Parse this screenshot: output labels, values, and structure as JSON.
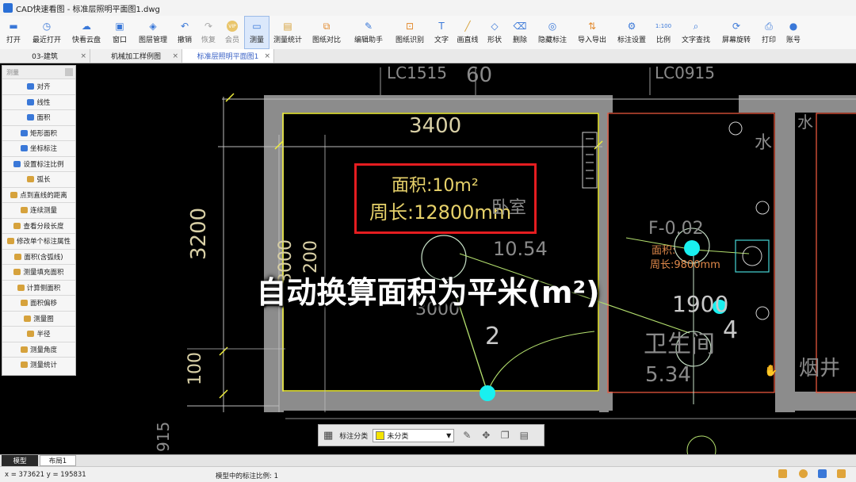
{
  "window": {
    "title": "CAD快速看图 - 标准层照明平面图1.dwg"
  },
  "ribbon": {
    "tools": [
      {
        "label": "打开",
        "icon": "folder-icon"
      },
      {
        "label": "最近打开",
        "icon": "clock-icon"
      },
      {
        "label": "快看云盘",
        "icon": "cloud-icon"
      },
      {
        "label": "窗口",
        "icon": "window-icon"
      },
      {
        "label": "图层管理",
        "icon": "layers-icon"
      },
      {
        "label": "撤销",
        "icon": "undo-icon"
      },
      {
        "label": "恢复",
        "icon": "redo-icon"
      },
      {
        "label": "会员",
        "icon": "vip-icon"
      },
      {
        "label": "测量",
        "icon": "measure-icon"
      },
      {
        "label": "测量统计",
        "icon": "measure-stats-icon"
      },
      {
        "label": "图纸对比",
        "icon": "compare-icon"
      },
      {
        "label": "编辑助手",
        "icon": "edit-helper-icon"
      },
      {
        "label": "图纸识别",
        "icon": "recognize-icon"
      },
      {
        "label": "文字",
        "icon": "text-icon"
      },
      {
        "label": "画直线",
        "icon": "line-icon"
      },
      {
        "label": "形状",
        "icon": "shape-icon"
      },
      {
        "label": "删除",
        "icon": "eraser-icon"
      },
      {
        "label": "隐藏标注",
        "icon": "hide-icon"
      },
      {
        "label": "导入导出",
        "icon": "import-export-icon"
      },
      {
        "label": "标注设置",
        "icon": "settings-icon"
      },
      {
        "label": "比例",
        "icon": "scale-icon"
      },
      {
        "label": "文字查找",
        "icon": "search-icon"
      },
      {
        "label": "屏幕旋转",
        "icon": "rotate-icon"
      },
      {
        "label": "打印",
        "icon": "print-icon"
      },
      {
        "label": "账号",
        "icon": "user-icon"
      }
    ],
    "scale_icon_text": "1:100",
    "vip_icon_text": "VIP"
  },
  "tabs": [
    {
      "label": "03-建筑"
    },
    {
      "label": "机械加工样例图"
    },
    {
      "label": "标准层照明平面图1"
    }
  ],
  "measure_panel": {
    "header": "测量",
    "items": [
      "对齐",
      "线性",
      "面积",
      "矩形面积",
      "坐标标注",
      "设置标注比例",
      "弧长",
      "点到直线的距离",
      "连续测量",
      "查看分段长度",
      "修改单个标注属性",
      "面积(含弧线)",
      "测量填充面积",
      "计算侧面积",
      "面积偏移",
      "测量图",
      "半径",
      "测量角度",
      "测量统计"
    ]
  },
  "drawing": {
    "dim_top": "3400",
    "dim_left": "3200",
    "dim_left2": "3000",
    "dim_left3": "200",
    "dim_left4": "100",
    "dim_bottom_left": "915",
    "top_label_1": "LC1515",
    "top_label_2": "60",
    "top_label_3": "LC0915",
    "measure_area": "面积:10m²",
    "measure_perimeter": "周长:12800mm",
    "room_label": "卧室",
    "room_area": "10.54",
    "mid_dim": "3000",
    "wire_num": "2",
    "right_label": "F-0.02",
    "right_area_small": "面积:",
    "right_perim_small": "周长:9800mm",
    "dim_1900": "1900",
    "num_4": "4",
    "bath_label": "卫生间",
    "bath_area": "5.34",
    "water_label": "水",
    "flue_label": "烟井",
    "top_right_char": "水"
  },
  "overlay_caption": "自动换算面积为平米(m²)",
  "floatbar": {
    "label": "标注分类",
    "selected": "未分类",
    "swatch_color": "#f4e300"
  },
  "bottom_tabs": [
    {
      "label": "模型"
    },
    {
      "label": "布局1"
    }
  ],
  "status": {
    "coords": "x = 373621  y = 195831",
    "scale": "模型中的标注比例: 1"
  }
}
